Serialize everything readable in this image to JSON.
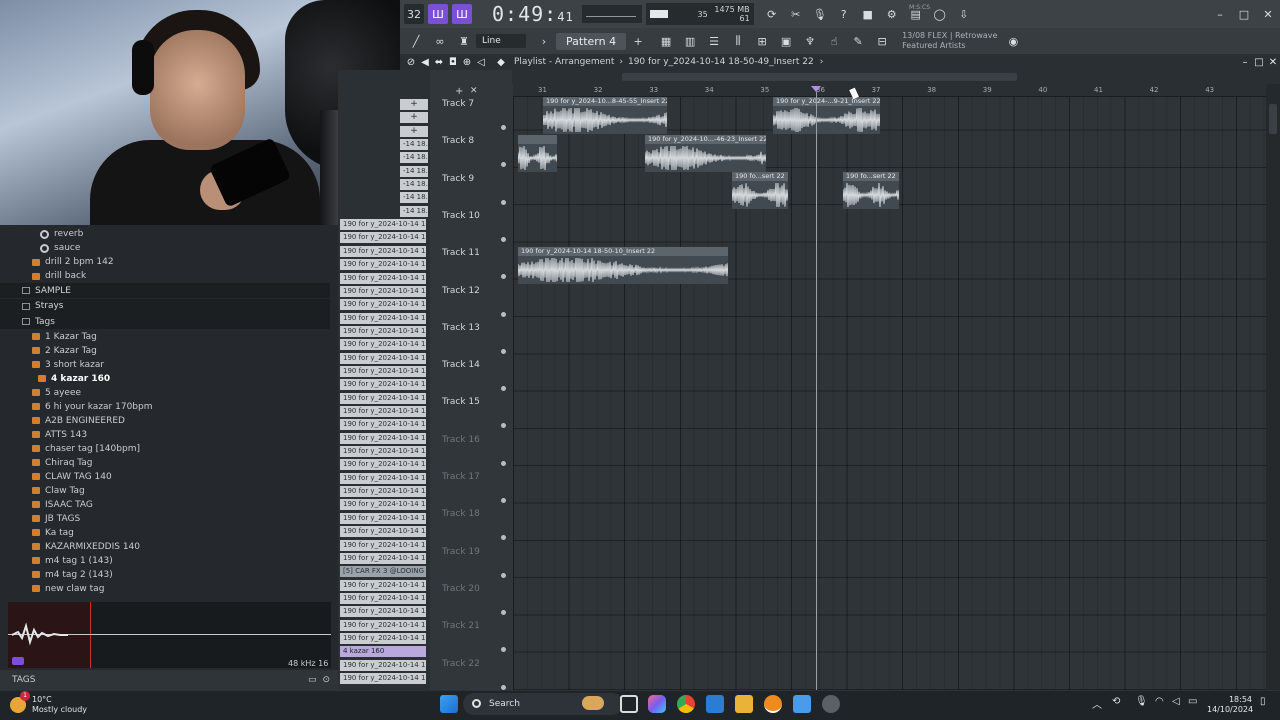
{
  "toolbar": {
    "time_main": "0:49",
    "time_sub": "41",
    "time_unit": "M:S:CS",
    "tempo_box": "32",
    "cpu_value": "35",
    "memory": "1475 MB",
    "memory_sub": "61",
    "pattern": "Pattern 4",
    "snap": "Line",
    "hint_line1": "13/08  FLEX | Retrowave",
    "hint_line2": "Featured Artists"
  },
  "playlist": {
    "breadcrumb": "Playlist - Arrangement",
    "separator": "›",
    "current_clip": "190 for y_2024-10-14 18-50-49_Insert 22",
    "bar_numbers": [
      "31",
      "32",
      "33",
      "34",
      "35",
      "36",
      "37",
      "38",
      "39",
      "40",
      "41",
      "42",
      "43"
    ]
  },
  "tracks": [
    {
      "name": "Track 7",
      "dim": false
    },
    {
      "name": "Track 8",
      "dim": false
    },
    {
      "name": "Track 9",
      "dim": false
    },
    {
      "name": "Track 10",
      "dim": false
    },
    {
      "name": "Track 11",
      "dim": false
    },
    {
      "name": "Track 12",
      "dim": false
    },
    {
      "name": "Track 13",
      "dim": false
    },
    {
      "name": "Track 14",
      "dim": false
    },
    {
      "name": "Track 15",
      "dim": false
    },
    {
      "name": "Track 16",
      "dim": true
    },
    {
      "name": "Track 17",
      "dim": true
    },
    {
      "name": "Track 18",
      "dim": true
    },
    {
      "name": "Track 19",
      "dim": true
    },
    {
      "name": "Track 20",
      "dim": true
    },
    {
      "name": "Track 21",
      "dim": true
    },
    {
      "name": "Track 22",
      "dim": true
    }
  ],
  "clips": [
    {
      "label": "190 for y_2024-10...8-45-55_Insert 22"
    },
    {
      "label": "190 for y_2024-...9-21_Insert 22"
    },
    {
      "label": ""
    },
    {
      "label": "190 for y_2024-10...-46-23_Insert 22"
    },
    {
      "label": "190 fo...sert 22"
    },
    {
      "label": "190 fo...sert 22"
    },
    {
      "label": "190 for y_2024-10-14 18-50-10_Insert 22"
    }
  ],
  "clip_list": {
    "short_label": "-14 18.",
    "long_label": "190 for y_2024-10-14 18.",
    "car_fx": "[5] CAR FX 3 @LOOING",
    "kazar": "4 kazar 160",
    "plus": "+"
  },
  "browser": {
    "items": [
      {
        "label": "reverb",
        "kind": "gear",
        "indent": 1
      },
      {
        "label": "sauce",
        "kind": "gear",
        "indent": 1
      },
      {
        "label": "drill 2 bpm 142",
        "kind": "file",
        "indent": 0
      },
      {
        "label": "drill back",
        "kind": "file",
        "indent": 0
      },
      {
        "label": "SAMPLE",
        "kind": "folder",
        "indent": 0
      },
      {
        "label": "Strays",
        "kind": "folder",
        "indent": 0
      },
      {
        "label": "Tags",
        "kind": "folder",
        "indent": 0
      },
      {
        "label": "1 Kazar Tag",
        "kind": "file",
        "indent": 1
      },
      {
        "label": "2 Kazar Tag",
        "kind": "file",
        "indent": 1
      },
      {
        "label": "3 short kazar",
        "kind": "file",
        "indent": 1
      },
      {
        "label": "4 kazar 160",
        "kind": "file",
        "indent": 2,
        "selected": true
      },
      {
        "label": "5 ayeee",
        "kind": "file",
        "indent": 1
      },
      {
        "label": "6 hi your kazar 170bpm",
        "kind": "file",
        "indent": 1
      },
      {
        "label": "A2B ENGINEERED",
        "kind": "file",
        "indent": 1
      },
      {
        "label": "ATTS 143",
        "kind": "file",
        "indent": 1
      },
      {
        "label": "chaser tag [140bpm]",
        "kind": "file",
        "indent": 1
      },
      {
        "label": "Chiraq Tag",
        "kind": "file",
        "indent": 1
      },
      {
        "label": "CLAW TAG 140",
        "kind": "file",
        "indent": 1
      },
      {
        "label": "Claw Tag",
        "kind": "file",
        "indent": 1
      },
      {
        "label": "ISAAC TAG",
        "kind": "file",
        "indent": 1
      },
      {
        "label": "JB TAGS",
        "kind": "file",
        "indent": 1
      },
      {
        "label": "Ka tag",
        "kind": "file",
        "indent": 1
      },
      {
        "label": "KAZARMIXEDDIS 140",
        "kind": "file",
        "indent": 1
      },
      {
        "label": "m4 tag 1 (143)",
        "kind": "file",
        "indent": 1
      },
      {
        "label": "m4 tag 2 (143)",
        "kind": "file",
        "indent": 1
      },
      {
        "label": "new claw tag",
        "kind": "file",
        "indent": 1
      }
    ],
    "tags_label": "TAGS",
    "sample_rate": "48 kHz 16"
  },
  "taskbar": {
    "temperature": "10°C",
    "weather": "Mostly cloudy",
    "search": "Search",
    "time": "18:54",
    "date": "14/10/2024",
    "notif": "1"
  },
  "colors": {
    "accent": "#7b4fd6",
    "clip_body": "#414a50",
    "clip_title": "#5c656b",
    "wave": "#d4d9dd"
  }
}
